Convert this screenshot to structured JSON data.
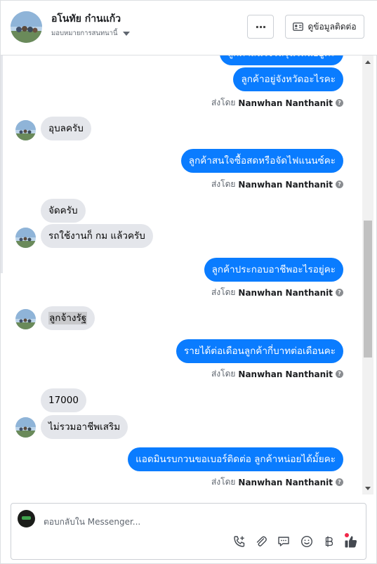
{
  "header": {
    "contact_name": "อโนทัย ก๋านแก้ว",
    "assign_label": "มอบหมายการสนทนานี้",
    "more_label": "···",
    "contact_info_label": "ดูข้อมูลติดต่อ"
  },
  "messages": {
    "out_partial": "ลูกค้าสนใจรถรุ่นไหนอยู่คะ",
    "out_1": "ลูกค้าอยู่จังหวัดอะไรคะ",
    "in_1": "อุบลครับ",
    "out_2": "ลูกค้าสนใจซื้อสดหรือจัดไฟแนนซ์คะ",
    "in_2a": "จัดครับ",
    "in_2b": "รถใช้งานก็ กม แล้วครับ",
    "out_3": "ลูกค้าประกอบอาชีพอะไรอยู่คะ",
    "in_3": "ลูกจ้างรัฐ",
    "out_4": "รายได้ต่อเดือนลูกค้ากี่บาทต่อเดือนคะ",
    "in_4a": "17000",
    "in_4b": "ไม่รวมอาชีพเสริม",
    "out_5": "แอดมินรบกวนขอเบอร์ติดต่อ ลูกค้าหน่อยได้มั้ยคะ",
    "sent_by_prefix": "ส่งโดย",
    "sender_name": "Nanwhan Nanthanit",
    "info_glyph": "?"
  },
  "composer": {
    "placeholder": "ตอบกลับใน Messenger...",
    "icons": [
      "phone-plus-icon",
      "attachment-icon",
      "saved-reply-icon",
      "emoji-icon",
      "payment-icon",
      "like-icon"
    ]
  },
  "colors": {
    "outgoing_bubble": "#0a7cff",
    "incoming_bubble": "#e4e6eb",
    "like_icon": "#444950",
    "notification_dot": "#f02849"
  }
}
